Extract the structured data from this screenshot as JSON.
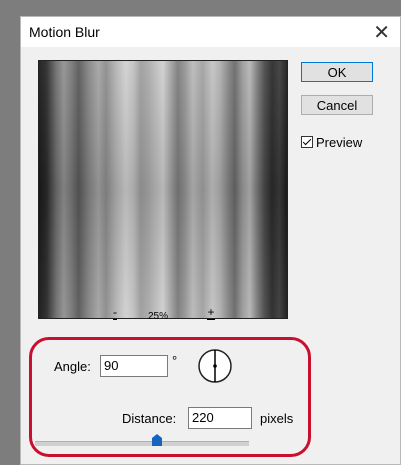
{
  "dialog": {
    "title": "Motion Blur",
    "close_glyph": "✕"
  },
  "buttons": {
    "ok": "OK",
    "cancel": "Cancel"
  },
  "preview_checkbox": {
    "label": "Preview",
    "checked": true
  },
  "zoom": {
    "minus": "-",
    "level": "25%",
    "plus": "+"
  },
  "angle": {
    "label": "Angle:",
    "value": "90",
    "unit": "°"
  },
  "distance": {
    "label": "Distance:",
    "value": "220",
    "unit": "pixels",
    "slider_fraction": 0.57
  },
  "icons": {
    "close": "close-icon",
    "dial": "angle-dial-icon",
    "checkbox": "check-icon"
  },
  "colors": {
    "highlight": "#c8102e",
    "default_button_border": "#0078d7",
    "slider_thumb": "#1565c0"
  }
}
